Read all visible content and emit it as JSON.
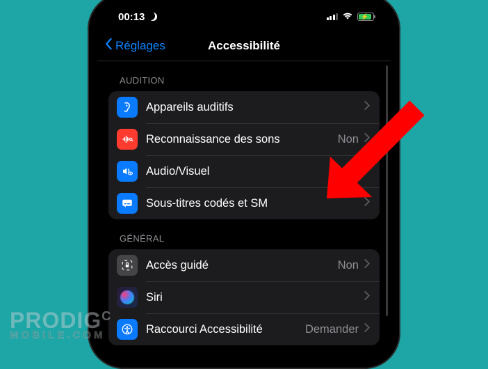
{
  "statusbar": {
    "time": "00:13"
  },
  "nav": {
    "back_label": "Réglages",
    "title": "Accessibilité"
  },
  "sections": {
    "audition": {
      "header": "AUDITION",
      "items": [
        {
          "label": "Appareils auditifs",
          "value": ""
        },
        {
          "label": "Reconnaissance des sons",
          "value": "Non"
        },
        {
          "label": "Audio/Visuel",
          "value": ""
        },
        {
          "label": "Sous-titres codés et SM",
          "value": ""
        }
      ]
    },
    "general": {
      "header": "GÉNÉRAL",
      "items": [
        {
          "label": "Accès guidé",
          "value": "Non"
        },
        {
          "label": "Siri",
          "value": ""
        },
        {
          "label": "Raccourci Accessibilité",
          "value": "Demander"
        }
      ]
    }
  },
  "watermark": {
    "line1_a": "PRODIG",
    "line1_b": "C",
    "line2": "MOBILE.COM"
  },
  "colors": {
    "page_bg": "#1ea5a5",
    "accent": "#0a84ff",
    "group_bg": "#1c1c1e",
    "arrow": "#ff0000",
    "battery_fill": "#34c759"
  }
}
